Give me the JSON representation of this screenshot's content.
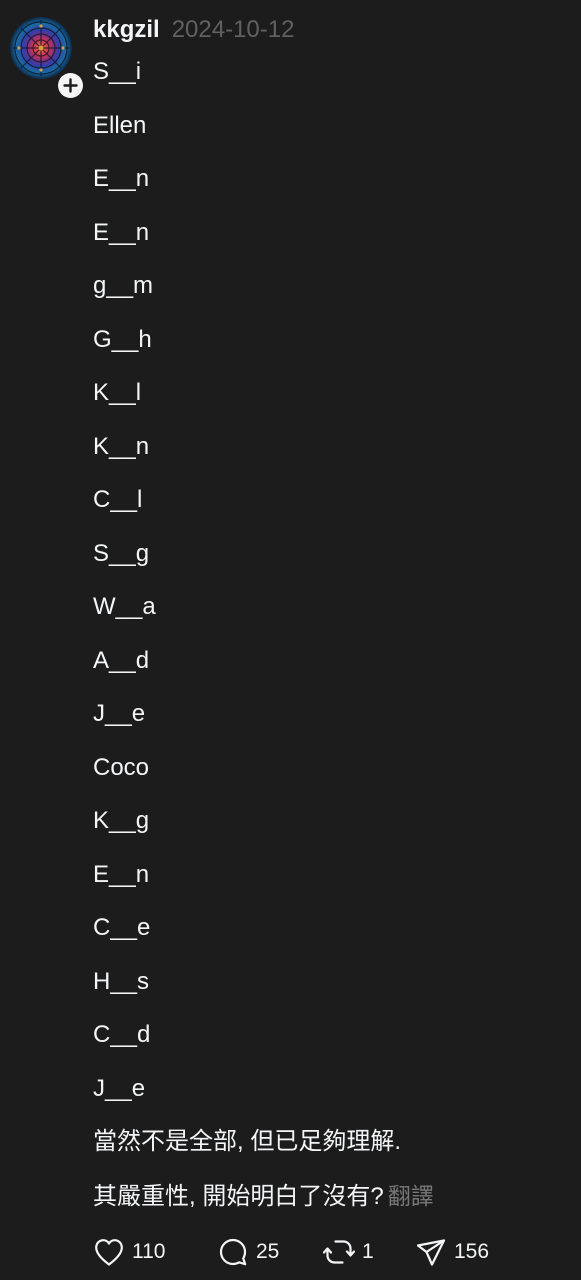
{
  "post": {
    "author": "kkgzil",
    "date": "2024-10-12",
    "follow_icon": "plus-icon",
    "lines": [
      "S__i",
      "Ellen",
      "E__n",
      "E__n",
      "g__m",
      "G__h",
      "K__l",
      "K__n",
      "C__l",
      "S__g",
      "W__a",
      "A__d",
      "J__e",
      "Coco",
      "K__g",
      "E__n",
      "C__e",
      "H__s",
      "C__d",
      "J__e",
      "當然不是全部, 但已足夠理解."
    ],
    "last_line": "其嚴重性, 開始明白了沒有?",
    "translate_label": "翻譯",
    "actions": {
      "likes": "110",
      "comments": "25",
      "reposts": "1",
      "shares": "156"
    }
  },
  "colors": {
    "background": "#1c1c1c",
    "text": "#f3f5f7",
    "muted": "#616161",
    "translate": "#777777"
  }
}
